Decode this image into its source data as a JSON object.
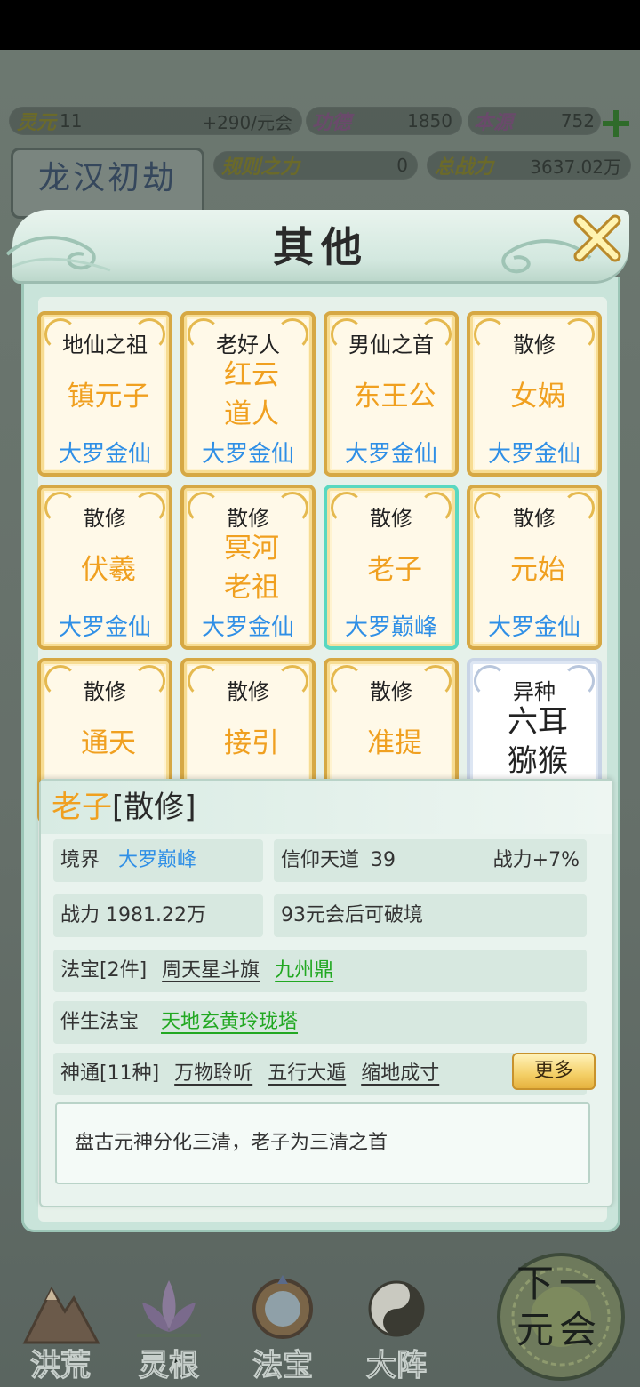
{
  "top": {
    "lingyuan_label": "灵元",
    "lingyuan_value": "11",
    "rate": "+290/元会",
    "gongde_label": "功德",
    "gongde_value": "1850",
    "benyuan_label": "本源",
    "benyuan_value": "752",
    "guize_label": "规则之力",
    "guize_value": "0",
    "zongzhanli_label": "总战力",
    "zongzhanli_value": "3637.02万",
    "era_title": "龙汉初劫"
  },
  "modal": {
    "title": "其他",
    "cards": [
      {
        "tag": "地仙之祖",
        "name": "镇元子",
        "realm": "大罗金仙"
      },
      {
        "tag": "老好人",
        "name": "红云道人",
        "realm": "大罗金仙"
      },
      {
        "tag": "男仙之首",
        "name": "东王公",
        "realm": "大罗金仙"
      },
      {
        "tag": "散修",
        "name": "女娲",
        "realm": "大罗金仙"
      },
      {
        "tag": "散修",
        "name": "伏羲",
        "realm": "大罗金仙"
      },
      {
        "tag": "散修",
        "name": "冥河老祖",
        "realm": "大罗金仙"
      },
      {
        "tag": "散修",
        "name": "老子",
        "realm": "大罗巅峰"
      },
      {
        "tag": "散修",
        "name": "元始",
        "realm": "大罗金仙"
      },
      {
        "tag": "散修",
        "name": "通天",
        "realm": ""
      },
      {
        "tag": "散修",
        "name": "接引",
        "realm": ""
      },
      {
        "tag": "散修",
        "name": "准提",
        "realm": ""
      },
      {
        "tag": "异种",
        "name": "六耳猕猴",
        "realm": ""
      }
    ]
  },
  "detail": {
    "name": "老子",
    "type": "[散修]",
    "realm_label": "境界",
    "realm_value": "大罗巅峰",
    "faith_label": "信仰天道",
    "faith_value": "39",
    "power_bonus": "战力+7%",
    "power": "战力 1981.22万",
    "breakthrough": "93元会后可破境",
    "treasure_label": "法宝[2件]",
    "treasures": [
      "周天星斗旗",
      "九州鼎"
    ],
    "companion_label": "伴生法宝",
    "companion_value": "天地玄黄玲珑塔",
    "skills_label": "神通[11种]",
    "skills": [
      "万物聆听",
      "五行大遁",
      "缩地成寸"
    ],
    "more_label": "更多",
    "description": "盘古元神分化三清，老子为三清之首"
  },
  "nav": {
    "items": [
      "洪荒",
      "灵根",
      "法宝",
      "大阵"
    ],
    "next_line1": "下一",
    "next_line2": "元会"
  }
}
